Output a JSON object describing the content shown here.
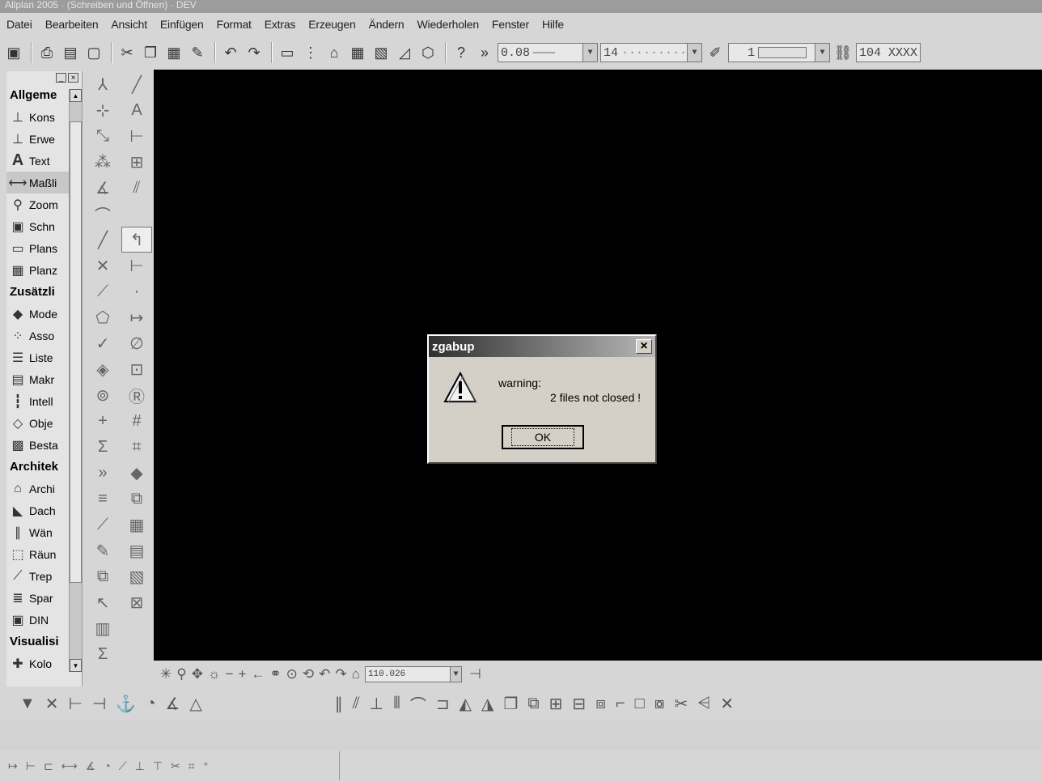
{
  "window": {
    "title": "Allplan 2005 · (Schreiben und Öffnen) · DEV"
  },
  "menu": [
    "Datei",
    "Bearbeiten",
    "Ansicht",
    "Einfügen",
    "Format",
    "Extras",
    "Erzeugen",
    "Ändern",
    "Wiederholen",
    "Fenster",
    "Hilfe"
  ],
  "toolbar": {
    "pen_value": "0.08",
    "line_value": "14",
    "color_value": "1",
    "layer_value": "104 XXXX"
  },
  "sidebar": {
    "categories": {
      "allgemein": "Allgeme",
      "zusaetzlich": "Zusätzli",
      "architektur": "Architek",
      "visualisierung": "Visualisi"
    },
    "items": {
      "kons": "Kons",
      "erwe": "Erwe",
      "text": "Text",
      "mass": "Maßli",
      "zoom": "Zoom",
      "schn": "Schn",
      "plans": "Plans",
      "planz": "Planz",
      "mode": "Mode",
      "asso": "Asso",
      "liste": "Liste",
      "makr": "Makr",
      "intel": "Intell",
      "obje": "Obje",
      "besta": "Besta",
      "archi": "Archi",
      "dach": "Dach",
      "waen": "Wän",
      "raeu": "Räun",
      "trep": "Trep",
      "spar": "Spar",
      "din": "DIN",
      "kolo": "Kolo"
    }
  },
  "bottombar": {
    "scale_value": "110.026"
  },
  "dialog": {
    "title": "zgabup",
    "line1": "warning:",
    "line2": "2 files not closed !",
    "ok_label": "OK",
    "close_label": "×"
  }
}
